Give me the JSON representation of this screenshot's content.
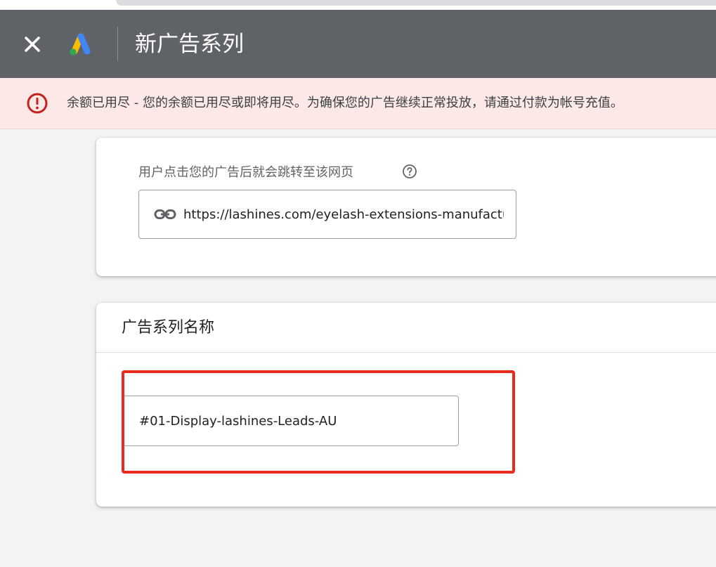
{
  "header": {
    "title": "新广告系列",
    "close_icon": "close-icon",
    "logo_icon": "google-ads-logo"
  },
  "alert": {
    "icon": "error-icon",
    "message": "余额已用尽 - 您的余额已用尽或即将用尽。为确保您的广告继续正常投放，请通过付款为帐号充值。"
  },
  "url_section": {
    "label": "用户点击您的广告后就会跳转至该网页",
    "help_icon": "help-icon",
    "link_icon": "link-icon",
    "value": "https://lashines.com/eyelash-extensions-manufacturer"
  },
  "campaign_name_section": {
    "title": "广告系列名称",
    "value": "#01-Display-lashines-Leads-AU"
  },
  "colors": {
    "header_bg": "#5f6368",
    "alert_bg": "#fce8e6",
    "alert_icon": "#c5221f",
    "highlight_border": "#ea2a1f",
    "page_bg": "#f1f3f4"
  }
}
